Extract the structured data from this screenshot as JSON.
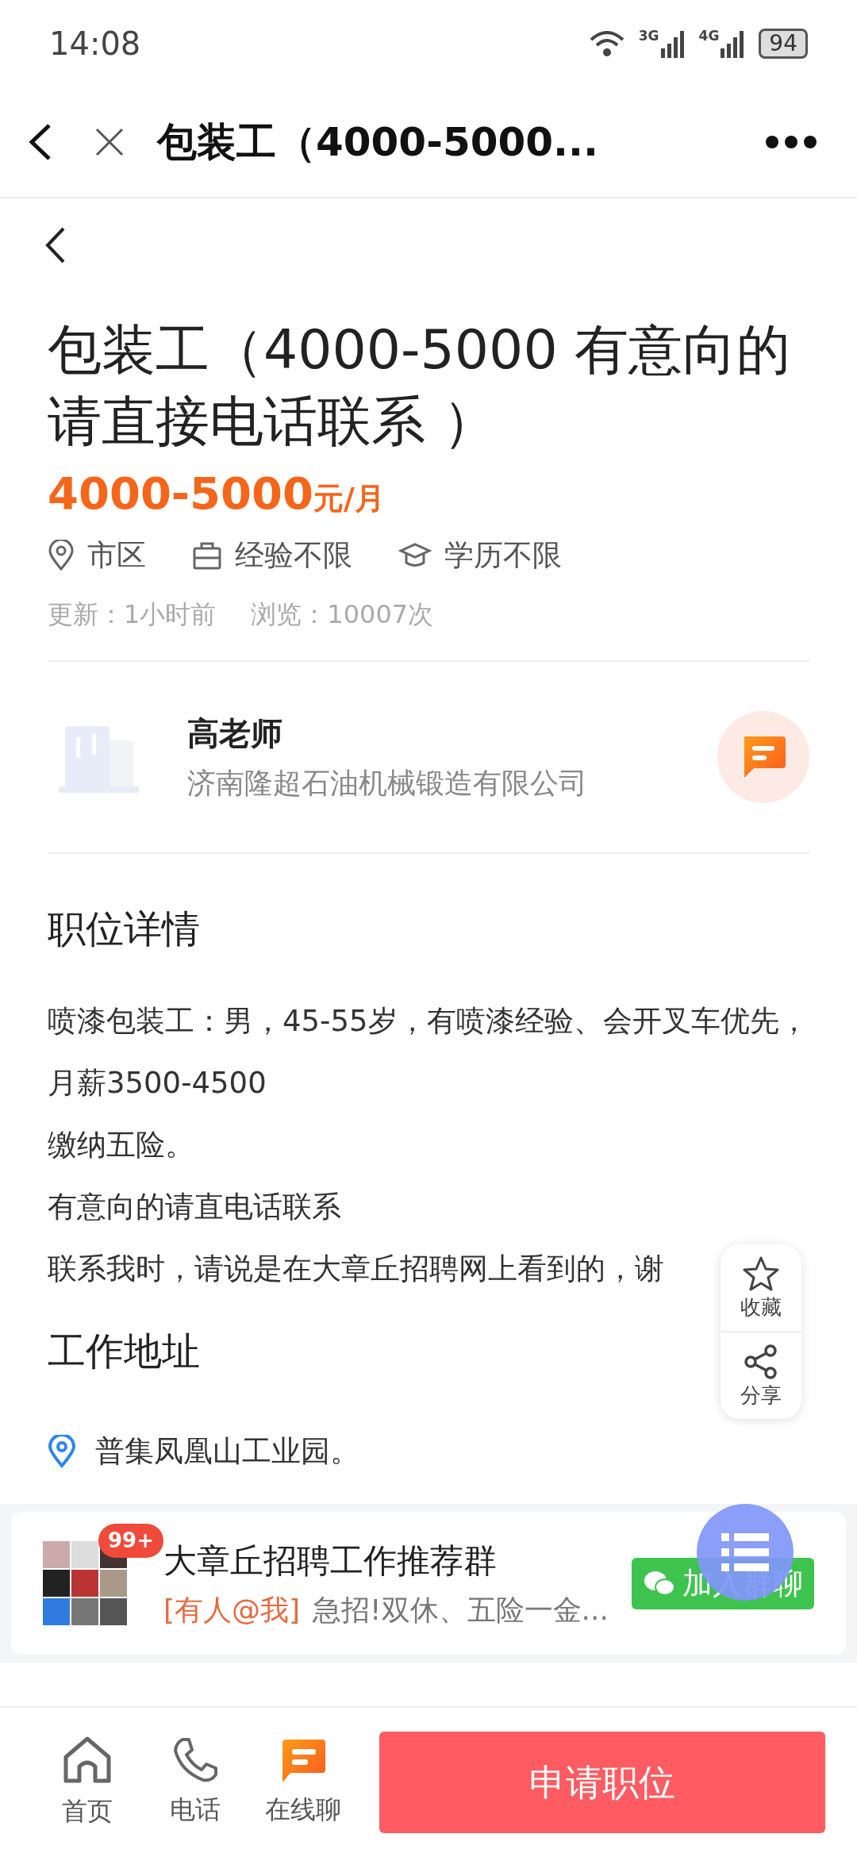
{
  "status_bar": {
    "time": "14:08",
    "networks": [
      "3G",
      "4G"
    ],
    "battery": "94"
  },
  "nav": {
    "title": "包装工（4000-5000..."
  },
  "job": {
    "title": "包装工（4000-5000 有意向的请直接电话联系 ）",
    "salary": "4000-5000",
    "salary_unit": "元/月",
    "tags": [
      {
        "kind": "location",
        "label": "市区"
      },
      {
        "kind": "experience",
        "label": "经验不限"
      },
      {
        "kind": "education",
        "label": "学历不限"
      }
    ],
    "updated": "更新：1小时前",
    "views": "浏览：10007次"
  },
  "contact": {
    "name": "高老师",
    "company": "济南隆超石油机械锻造有限公司"
  },
  "details": {
    "heading": "职位详情",
    "lines": [
      "喷漆包装工：男，45-55岁，有喷漆经验、会开叉车优先，月薪3500-4500",
      "缴纳五险。",
      "有意向的请直电话联系",
      "联系我时，请说是在大章丘招聘网上看到的，谢"
    ]
  },
  "address": {
    "heading": "工作地址",
    "text": "普集凤凰山工业园。"
  },
  "side_actions": [
    {
      "kind": "favorite",
      "label": "收藏"
    },
    {
      "kind": "share",
      "label": "分享"
    }
  ],
  "group": {
    "badge": "99+",
    "title": "大章丘招聘工作推荐群",
    "mention": "[有人@我]",
    "preview": "急招!双休、五险一金...",
    "join": "加入群聊"
  },
  "bottom_nav": [
    {
      "kind": "home",
      "label": "首页"
    },
    {
      "kind": "phone",
      "label": "电话"
    },
    {
      "kind": "chat",
      "label": "在线聊"
    }
  ],
  "apply": "申请职位"
}
